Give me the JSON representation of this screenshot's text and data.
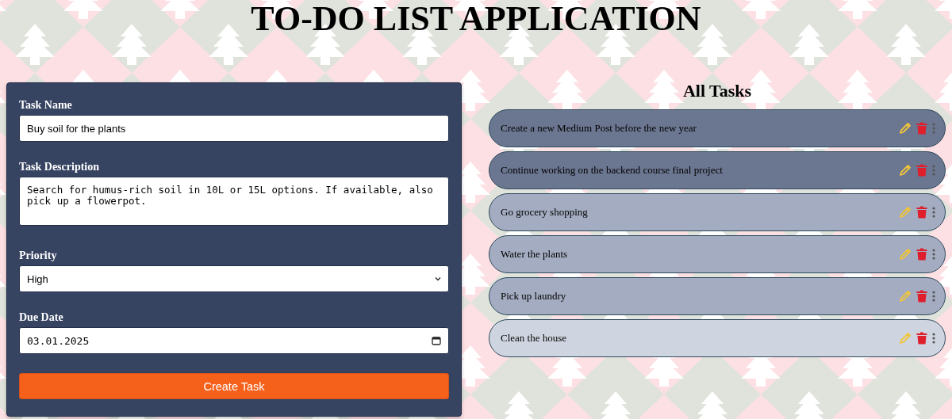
{
  "title": "TO-DO LIST APPLICATION",
  "form": {
    "fields": [
      {
        "kind": "text",
        "label": "Task Name",
        "value": "Buy soil for the plants"
      },
      {
        "kind": "textarea",
        "label": "Task Description",
        "value": "Search for humus-rich soil in 10L or 15L options. If available, also pick up a flowerpot."
      },
      {
        "kind": "select",
        "label": "Priority",
        "value": "High"
      },
      {
        "kind": "date",
        "label": "Due Date",
        "value": "03.01.2025"
      }
    ],
    "submit": "Create Task"
  },
  "tasks_heading": "All Tasks",
  "tasks": [
    {
      "title": "Create a new Medium Post before the new year",
      "color": "#6b7690"
    },
    {
      "title": "Continue working on the backend course final project",
      "color": "#6b7690"
    },
    {
      "title": "Go grocery shopping",
      "color": "#a3acc0"
    },
    {
      "title": "Water the plants",
      "color": "#a3acc0"
    },
    {
      "title": "Pick up laundry",
      "color": "#a3acc0"
    },
    {
      "title": "Clean the house",
      "color": "#cfd5e0"
    }
  ]
}
